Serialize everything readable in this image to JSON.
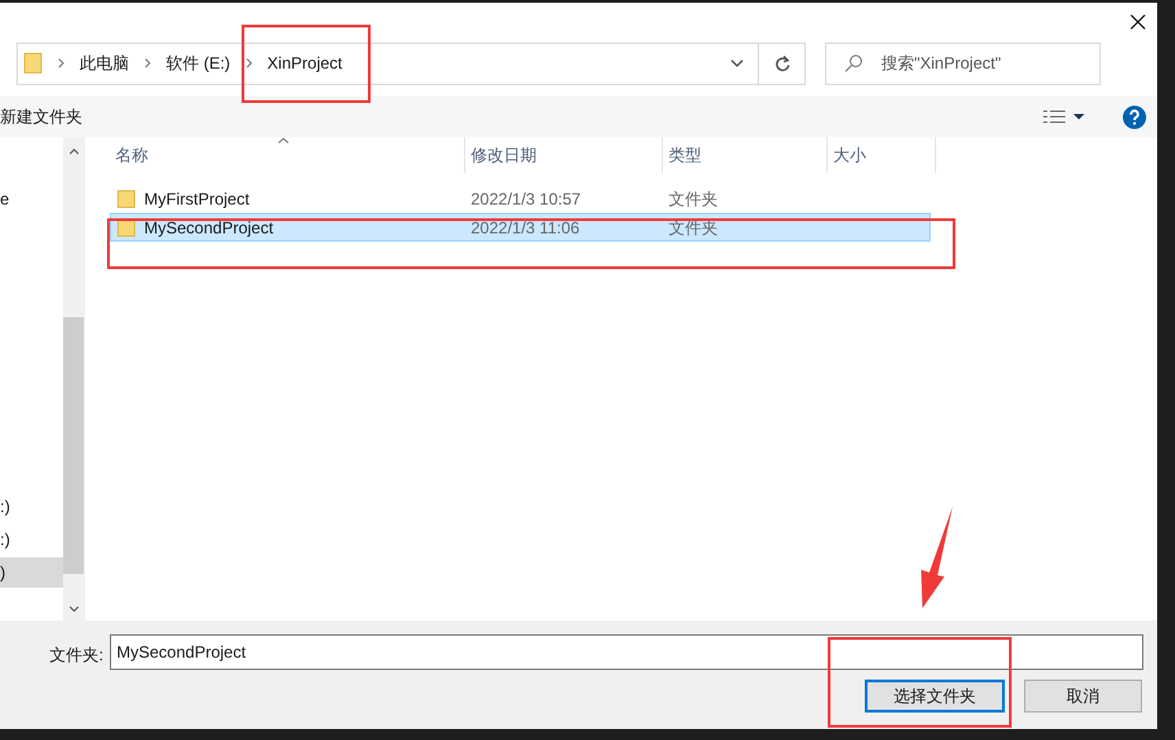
{
  "breadcrumb": [
    "此电脑",
    "软件 (E:)",
    "XinProject"
  ],
  "search": {
    "placeholder": "搜索\"XinProject\""
  },
  "toolbar": {
    "new_folder": "新建文件夹"
  },
  "sidebar": {
    "items": [
      {
        "label": "e",
        "selected": false
      },
      {
        "label": ":)",
        "selected": false
      },
      {
        "label": ":)",
        "selected": false
      },
      {
        "label": ")",
        "selected": true
      }
    ]
  },
  "table": {
    "columns": [
      "名称",
      "修改日期",
      "类型",
      "大小"
    ],
    "rows": [
      {
        "name": "MyFirstProject",
        "date": "2022/1/3 10:57",
        "type": "文件夹",
        "selected": false
      },
      {
        "name": "MySecondProject",
        "date": "2022/1/3 11:06",
        "type": "文件夹",
        "selected": true
      }
    ]
  },
  "folder_field": {
    "label": "文件夹:",
    "value": "MySecondProject"
  },
  "buttons": [
    {
      "label": "选择文件夹",
      "kind": "primary"
    },
    {
      "label": "取消",
      "kind": "secondary"
    }
  ]
}
